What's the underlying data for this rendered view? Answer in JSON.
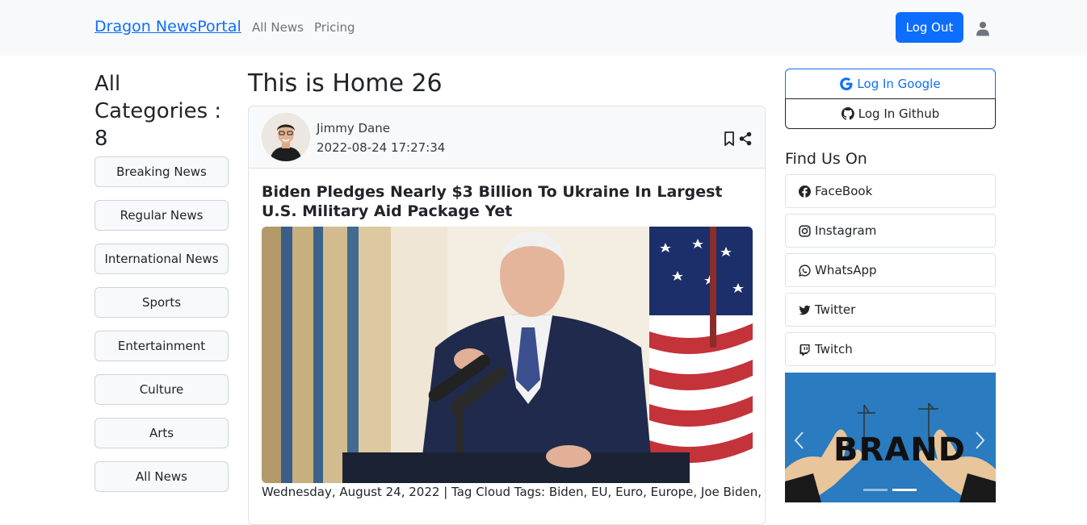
{
  "nav": {
    "brand": "Dragon NewsPortal",
    "links": [
      "All News",
      "Pricing"
    ],
    "logout": "Log Out"
  },
  "categories": {
    "heading": "All Categories : 8",
    "items": [
      "Breaking News",
      "Regular News",
      "International News",
      "Sports",
      "Entertainment",
      "Culture",
      "Arts",
      "All News"
    ]
  },
  "main": {
    "title": "This is Home 26",
    "card": {
      "author": "Jimmy Dane",
      "date": "2022-08-24 17:27:34",
      "headline": "Biden Pledges Nearly $3 Billion To Ukraine In Largest U.S. Military Aid Package Yet",
      "meta": "Wednesday, August 24, 2022 | Tag Cloud Tags: Biden, EU, Euro, Europe, Joe Biden,"
    }
  },
  "sidebar": {
    "login_google": "Log In Google",
    "login_github": "Log In Github",
    "find_heading": "Find Us On",
    "socials": [
      {
        "label": "FaceBook",
        "icon": "facebook-icon"
      },
      {
        "label": "Instagram",
        "icon": "instagram-icon"
      },
      {
        "label": "WhatsApp",
        "icon": "whatsapp-icon"
      },
      {
        "label": "Twitter",
        "icon": "twitter-icon"
      },
      {
        "label": "Twitch",
        "icon": "twitch-icon"
      }
    ],
    "carousel_text": "BRAND"
  },
  "colors": {
    "primary": "#0d6efd",
    "navbar_bg": "#f8f9fa",
    "carousel_bg": "#2a7bbf"
  }
}
